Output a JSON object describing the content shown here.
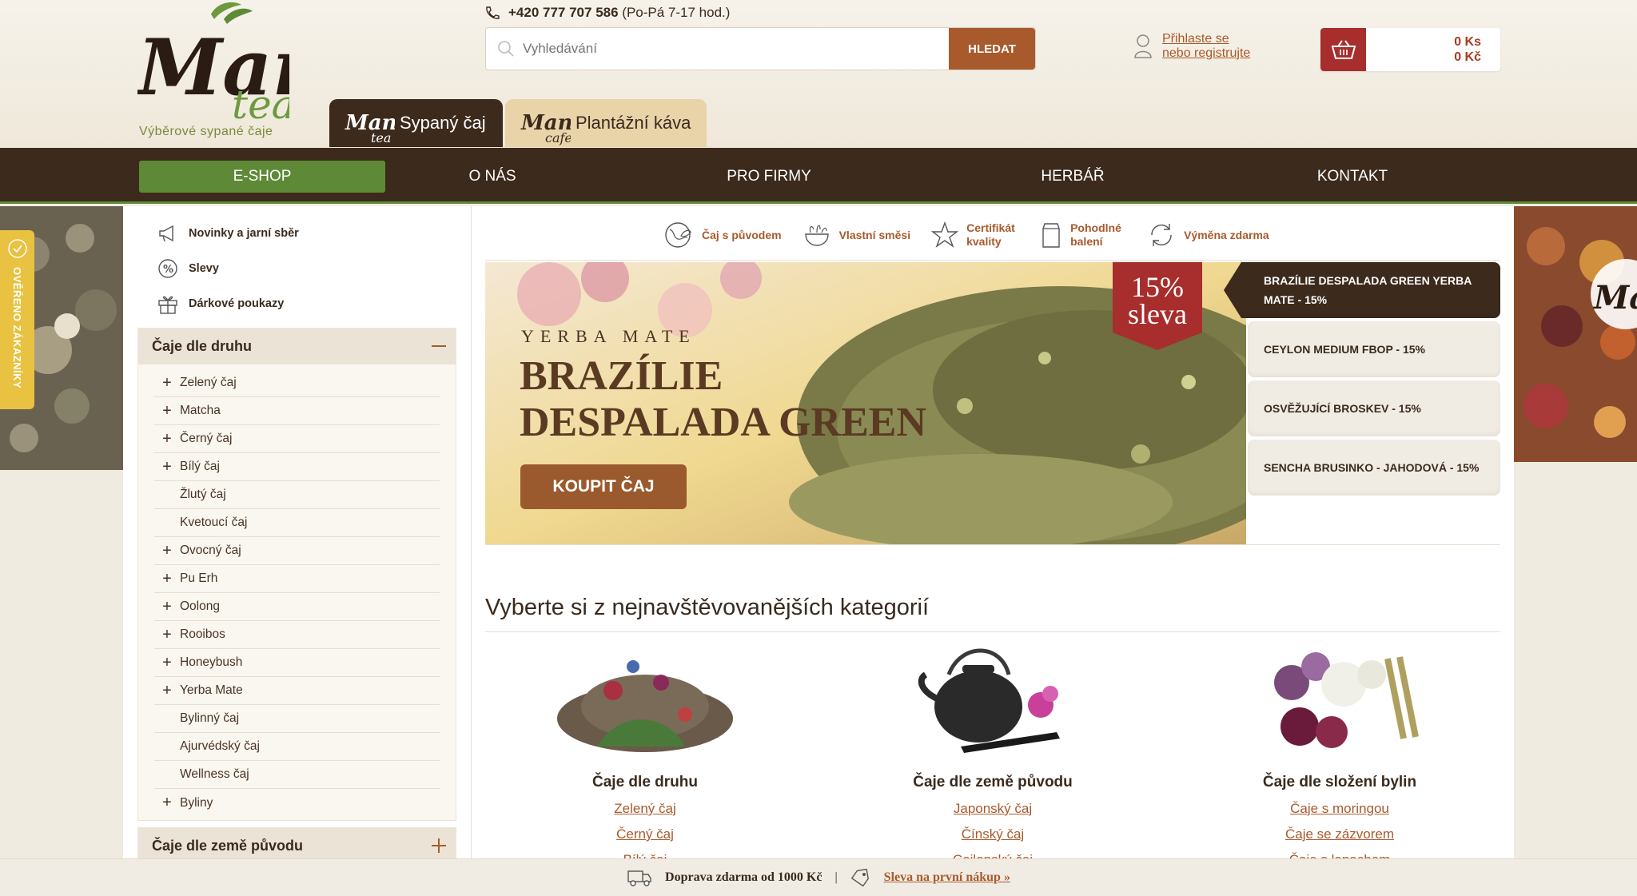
{
  "brand": {
    "logo_text": "Manu tea",
    "tagline": "Výběrové sypané čaje"
  },
  "contact": {
    "phone": "+420 777 707 586",
    "hours": "(Po-Pá 7-17 hod.)"
  },
  "search": {
    "placeholder": "Vyhledávání",
    "button": "HLEDAT"
  },
  "account": {
    "line1": "Přihlaste se",
    "line2": "nebo registrujte"
  },
  "cart": {
    "count": "0 Ks",
    "total": "0 Kč"
  },
  "shop_tabs": [
    {
      "label": "Sypaný čaj",
      "logo": "Manu tea"
    },
    {
      "label": "Plantážní káva",
      "logo": "Manu cafe"
    }
  ],
  "nav": [
    "E-SHOP",
    "O NÁS",
    "PRO FIRMY",
    "HERBÁŘ",
    "KONTAKT"
  ],
  "verified_badge": "OVĚŘENO ZÁKAZNÍKY",
  "sidebar": {
    "top_links": [
      {
        "label": "Novinky a jarní sběr",
        "icon": "megaphone-icon"
      },
      {
        "label": "Slevy",
        "icon": "percent-icon"
      },
      {
        "label": "Dárkové poukazy",
        "icon": "gift-icon"
      }
    ],
    "category1": {
      "title": "Čaje dle druhu",
      "items": [
        {
          "label": "Zelený čaj",
          "expandable": true
        },
        {
          "label": "Matcha",
          "expandable": true
        },
        {
          "label": "Černý čaj",
          "expandable": true
        },
        {
          "label": "Bílý čaj",
          "expandable": true
        },
        {
          "label": "Žlutý čaj",
          "expandable": false
        },
        {
          "label": "Kvetoucí čaj",
          "expandable": false
        },
        {
          "label": "Ovocný čaj",
          "expandable": true
        },
        {
          "label": "Pu Erh",
          "expandable": true
        },
        {
          "label": "Oolong",
          "expandable": true
        },
        {
          "label": "Rooibos",
          "expandable": true
        },
        {
          "label": "Honeybush",
          "expandable": true
        },
        {
          "label": "Yerba Mate",
          "expandable": true
        },
        {
          "label": "Bylinný čaj",
          "expandable": false
        },
        {
          "label": "Ajurvédský čaj",
          "expandable": false
        },
        {
          "label": "Wellness čaj",
          "expandable": false
        },
        {
          "label": "Byliny",
          "expandable": true
        }
      ]
    },
    "category2": {
      "title": "Čaje dle země původu"
    }
  },
  "features": [
    {
      "label": "Čaj s původem",
      "icon": "globe-leaf-icon"
    },
    {
      "label": "Vlastní směsi",
      "icon": "mortar-icon"
    },
    {
      "label": "Certifikát kvality",
      "icon": "star-icon"
    },
    {
      "label": "Pohodlné balení",
      "icon": "package-icon"
    },
    {
      "label": "Výměna zdarma",
      "icon": "exchange-icon"
    }
  ],
  "banner": {
    "subtitle": "YERBA MATE",
    "title_line1": "BRAZÍLIE",
    "title_line2": "DESPALADA GREEN",
    "button": "KOUPIT ČAJ",
    "badge_pct": "15%",
    "badge_word": "sleva"
  },
  "slides": [
    "BRAZÍLIE DESPALADA GREEN YERBA MATE - 15%",
    "CEYLON MEDIUM FBOP - 15%",
    "OSVĚŽUJÍCÍ BROSKEV - 15%",
    "SENCHA BRUSINKO - JAHODOVÁ - 15%"
  ],
  "categories_section": {
    "title": "Vyberte si z nejnavštěvovanějších kategorií",
    "columns": [
      {
        "title": "Čaje dle druhu",
        "links": [
          "Zelený čaj",
          "Černý čaj",
          "Bílý čaj"
        ]
      },
      {
        "title": "Čaje dle země původu",
        "links": [
          "Japonský čaj",
          "Čínský čaj",
          "Cejlonský čaj"
        ]
      },
      {
        "title": "Čaje dle složení bylin",
        "links": [
          "Čaje s moringou",
          "Čaje se zázvorem",
          "Čaje s lapachem"
        ]
      }
    ]
  },
  "bottom_bar": {
    "shipping": "Doprava zdarma od 1000 Kč",
    "separator": "|",
    "promo": "Sleva na první nákup »"
  },
  "colors": {
    "brown": "#3c2a1c",
    "green": "#5e8a38",
    "accent": "#a85a2c",
    "red": "#a82d2d"
  }
}
